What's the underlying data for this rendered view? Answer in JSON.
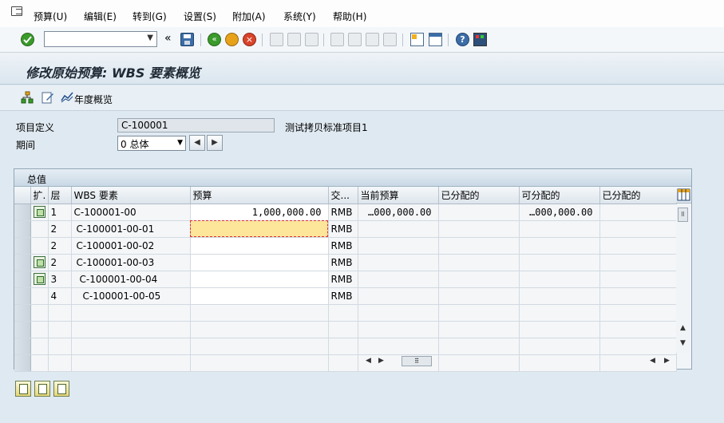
{
  "menu": {
    "items": [
      "预算(U)",
      "编辑(E)",
      "转到(G)",
      "设置(S)",
      "附加(A)",
      "系统(Y)",
      "帮助(H)"
    ]
  },
  "toolbar": {
    "command_field_value": "",
    "back_double": "«"
  },
  "title": {
    "text": "修改原始预算: WBS 要素概览"
  },
  "app_toolbar": {
    "annual_overview_label": "年度概览"
  },
  "header": {
    "project_label": "项目定义",
    "project_value": "C-100001",
    "project_desc": "测试拷贝标准项目1",
    "period_label": "期间",
    "period_value": "0 总体"
  },
  "grid": {
    "panel_title": "总值",
    "columns": [
      "扩.",
      "层",
      "WBS 要素",
      "预算",
      "交...",
      "当前预算",
      "已分配的",
      "可分配的",
      "已分配的"
    ],
    "rows": [
      {
        "expand": true,
        "level": "1",
        "wbs": "C-100001-00",
        "budget": "1,000,000.00",
        "currency": "RMB",
        "current": "…000,000.00",
        "allocated": "",
        "distributable": "…000,000.00",
        "allocated2": ""
      },
      {
        "expand": false,
        "level": "2",
        "wbs": "C-100001-00-01",
        "budget": "",
        "currency": "RMB",
        "current": "",
        "allocated": "",
        "distributable": "",
        "allocated2": ""
      },
      {
        "expand": false,
        "level": "2",
        "wbs": "C-100001-00-02",
        "budget": "",
        "currency": "RMB",
        "current": "",
        "allocated": "",
        "distributable": "",
        "allocated2": ""
      },
      {
        "expand": true,
        "level": "2",
        "wbs": "C-100001-00-03",
        "budget": "",
        "currency": "RMB",
        "current": "",
        "allocated": "",
        "distributable": "",
        "allocated2": ""
      },
      {
        "expand": true,
        "level": "3",
        "wbs": "C-100001-00-04",
        "budget": "",
        "currency": "RMB",
        "current": "",
        "allocated": "",
        "distributable": "",
        "allocated2": ""
      },
      {
        "expand": false,
        "level": "4",
        "wbs": "C-100001-00-05",
        "budget": "",
        "currency": "RMB",
        "current": "",
        "allocated": "",
        "distributable": "",
        "allocated2": ""
      }
    ]
  },
  "colors": {
    "active_cell": "#fde69a",
    "ok_icon": "#3a9a2a",
    "exit_icon": "#e8a21a",
    "cancel_icon": "#d9432a"
  }
}
